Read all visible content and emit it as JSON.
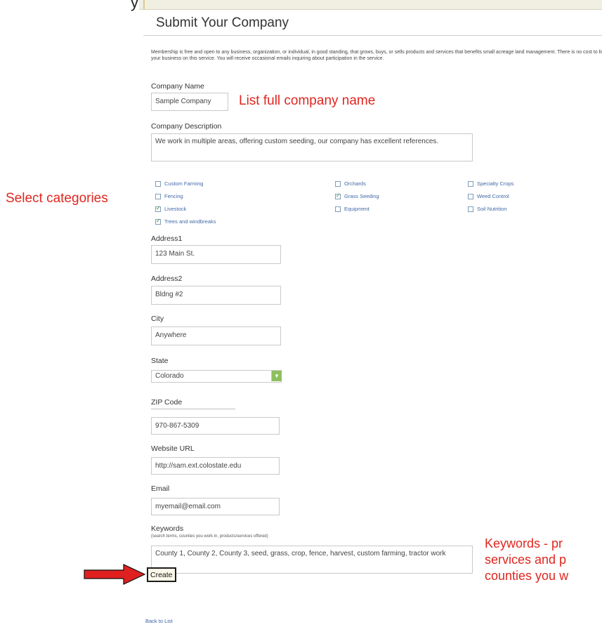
{
  "title": "Submit Your Company",
  "top_clip": "y",
  "intro": "Membership is free and open to any business, organization, or individual, in good standing, that grows, buys, or sells products and services that benefits small acreage land management. There is no cost to list your business on this service. You will receive occasional emails inquiring about participation in the service.",
  "company_name": {
    "label": "Company Name",
    "value": "Sample Company",
    "note": "List full company name"
  },
  "company_description": {
    "label": "Company Description",
    "value": "We work in multiple areas, offering custom seeding, our company has excellent references."
  },
  "categories_note": "Select categories",
  "categories": [
    {
      "label": "Custom Farming",
      "checked": false
    },
    {
      "label": "Fencing",
      "checked": false
    },
    {
      "label": "Livestock",
      "checked": true
    },
    {
      "label": "Trees and windbreaks",
      "checked": true
    },
    {
      "label": "Orchards",
      "checked": false
    },
    {
      "label": "Grass Seeding",
      "checked": true
    },
    {
      "label": "Equipment",
      "checked": false
    },
    {
      "label": "Specialty Crops",
      "checked": false
    },
    {
      "label": "Weed Control",
      "checked": false
    },
    {
      "label": "Soil Nutrition",
      "checked": false
    }
  ],
  "address1": {
    "label": "Address1",
    "value": "123 Main St."
  },
  "address2": {
    "label": "Address2",
    "value": "Bldng #2"
  },
  "city": {
    "label": "City",
    "value": "Anywhere"
  },
  "state": {
    "label": "State",
    "value": "Colorado"
  },
  "zip": {
    "label": "ZIP Code",
    "value": "970-867-5309"
  },
  "website": {
    "label": "Website URL",
    "value": "http://sam.ext.colostate.edu"
  },
  "email": {
    "label": "Email",
    "value": "myemail@email.com"
  },
  "keywords": {
    "label": "Keywords",
    "hint": "(search terms, counties you work in, products/services offered)",
    "value": "County 1, County 2, County 3, seed, grass, crop, fence, harvest, custom farming, tractor work",
    "note_line1": "Keywords - pr",
    "note_line2": "services and p",
    "note_line3": "counties you w"
  },
  "create_label": "Create",
  "back_label": "Back to List",
  "colors": {
    "annotation": "#e0261f",
    "arrow": "#e02020",
    "link": "#3b5ea7"
  }
}
